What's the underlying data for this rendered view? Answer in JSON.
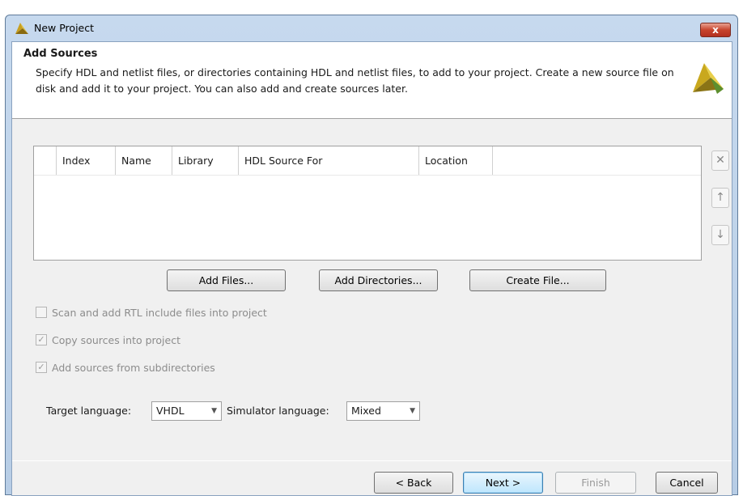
{
  "window": {
    "title": "New Project",
    "close_label": "x"
  },
  "header": {
    "title": "Add Sources",
    "description": "Specify HDL and netlist files, or directories containing HDL and netlist files, to add to your project. Create a new source file on disk and add it to your project. You can also add and create sources later."
  },
  "table": {
    "columns": [
      "Index",
      "Name",
      "Library",
      "HDL Source For",
      "Location"
    ],
    "rows": []
  },
  "side_buttons": {
    "remove": "✕",
    "up": "↑",
    "down": "↓"
  },
  "actions": {
    "add_files": "Add Files...",
    "add_directories": "Add Directories...",
    "create_file": "Create File..."
  },
  "options": {
    "scan_rtl": {
      "label": "Scan and add RTL include files into project",
      "checked": false
    },
    "copy_sources": {
      "label": "Copy sources into project",
      "checked": true
    },
    "subdirectories": {
      "label": "Add sources from subdirectories",
      "checked": true
    }
  },
  "language": {
    "target_label": "Target language:",
    "target_value": "VHDL",
    "simulator_label": "Simulator language:",
    "simulator_value": "Mixed"
  },
  "footer": {
    "back": "< Back",
    "next": "Next >",
    "finish": "Finish",
    "cancel": "Cancel"
  }
}
